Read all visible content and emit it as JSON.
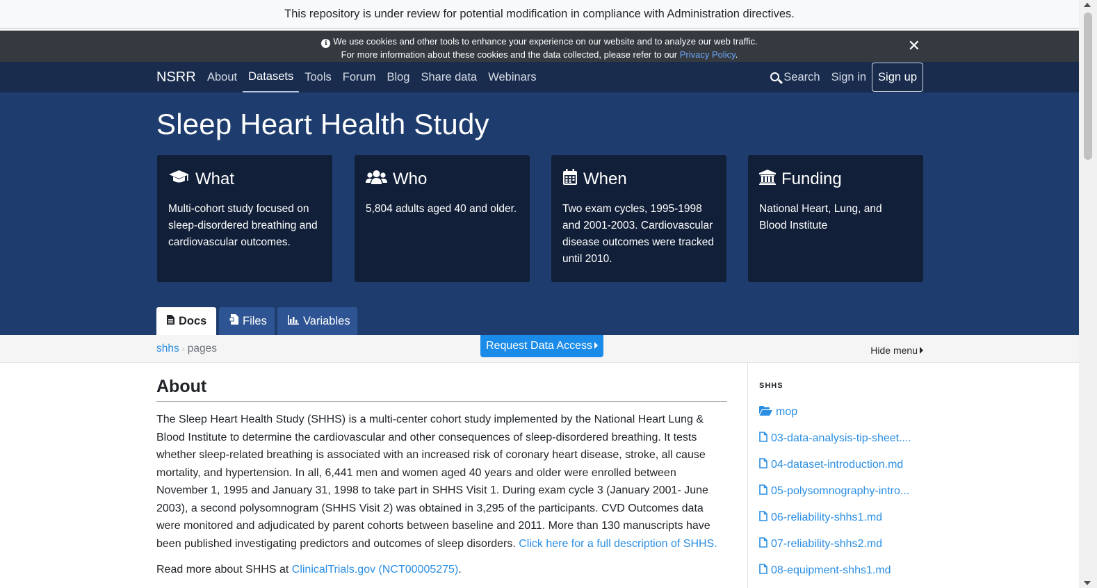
{
  "review_notice": "This repository is under review for potential modification in compliance with Administration directives.",
  "cookie": {
    "line1": "We use cookies and other tools to enhance your experience on our website and to analyze our web traffic.",
    "line2_prefix": "For more information about these cookies and the data collected, please refer to our ",
    "privacy_link": "Privacy Policy",
    "line2_suffix": ".",
    "close": "✕"
  },
  "nav": {
    "brand": "NSRR",
    "links": [
      "About",
      "Datasets",
      "Tools",
      "Forum",
      "Blog",
      "Share data",
      "Webinars"
    ],
    "active": "Datasets",
    "search": "Search",
    "signin": "Sign in",
    "signup": "Sign up"
  },
  "hero": {
    "title": "Sleep Heart Health Study",
    "cards": [
      {
        "icon": "graduation-cap-icon",
        "title": "What",
        "body": "Multi-cohort study focused on sleep-disordered breathing and cardiovascular outcomes."
      },
      {
        "icon": "users-icon",
        "title": "Who",
        "body": "5,804 adults aged 40 and older."
      },
      {
        "icon": "calendar-icon",
        "title": "When",
        "body": "Two exam cycles, 1995-1998 and 2001-2003. Cardiovascular disease outcomes were tracked until 2010."
      },
      {
        "icon": "university-icon",
        "title": "Funding",
        "body": "National Heart, Lung, and Blood Institute"
      }
    ]
  },
  "tabs": {
    "docs": "Docs",
    "files": "Files",
    "variables": "Variables"
  },
  "subnav": {
    "crumb_root": "shhs",
    "crumb_sep": "›",
    "crumb_current": "pages",
    "request_access": "Request Data Access",
    "hide_menu": "Hide menu"
  },
  "main": {
    "title": "About",
    "paragraph": "The Sleep Heart Health Study (SHHS) is a multi-center cohort study implemented by the National Heart Lung & Blood Institute to determine the cardiovascular and other consequences of sleep-disordered breathing. It tests whether sleep-related breathing is associated with an increased risk of coronary heart disease, stroke, all cause mortality, and hypertension.  In all, 6,441 men and women aged 40 years and older were enrolled between November 1, 1995 and January 31, 1998 to take part in SHHS Visit 1. During exam cycle 3 (January 2001- June 2003), a second polysomnogram (SHHS Visit 2) was obtained in 3,295 of the participants. CVD Outcomes data were monitored and adjudicated by parent cohorts between baseline and 2011. More than 130 manuscripts have been published investigating predictors and outcomes of sleep disorders.",
    "full_description_link": "Click here for a full description of SHHS.",
    "read_more_prefix": "Read more about SHHS at ",
    "read_more_link": "ClinicalTrials.gov (NCT00005275)",
    "read_more_suffix": "."
  },
  "sidebar": {
    "title": "SHHS",
    "items": [
      {
        "icon": "folder-open-icon",
        "label": "mop"
      },
      {
        "icon": "file-icon",
        "label": "03-data-analysis-tip-sheet...."
      },
      {
        "icon": "file-icon",
        "label": "04-dataset-introduction.md"
      },
      {
        "icon": "file-icon",
        "label": "05-polysomnography-intro..."
      },
      {
        "icon": "file-icon",
        "label": "06-reliability-shhs1.md"
      },
      {
        "icon": "file-icon",
        "label": "07-reliability-shhs2.md"
      },
      {
        "icon": "file-icon",
        "label": "08-equipment-shhs1.md"
      }
    ]
  },
  "colors": {
    "navbar": "#192c4e",
    "hero": "#1e3d6e",
    "card": "#111f38",
    "link": "#2a8ee3",
    "request_button": "#1a8be8"
  }
}
